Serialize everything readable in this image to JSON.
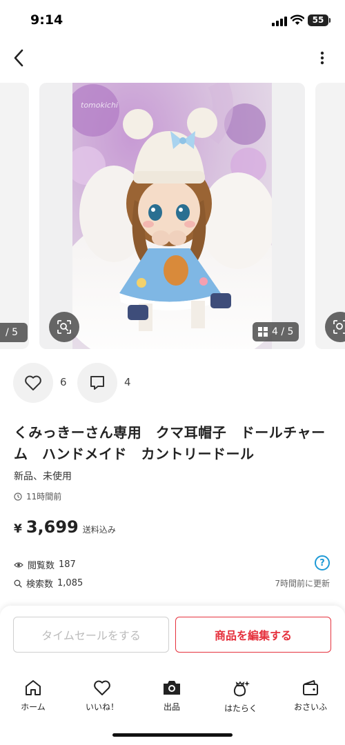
{
  "status_bar": {
    "time": "9:14",
    "battery": "55"
  },
  "icons": {
    "back": "chevron-left-icon",
    "more": "vertical-dots-icon",
    "lens": "image-search-icon",
    "grid": "grid-icon",
    "like": "heart-icon",
    "comment": "comment-icon",
    "clock": "clock-icon",
    "eye": "eye-icon",
    "search": "search-icon",
    "help": "help-icon"
  },
  "carousel": {
    "prev_counter": "/ 5",
    "counter": "4 / 5",
    "watermark": "tomokichi"
  },
  "actions": {
    "like_count": "6",
    "comment_count": "4"
  },
  "item": {
    "title": "くみっきーさん専用　クマ耳帽子　ドールチャーム　ハンドメイド　カントリードール",
    "condition": "新品、未使用",
    "posted": "11時間前",
    "price_currency": "¥",
    "price": "3,699",
    "price_note": "送料込み"
  },
  "stats": {
    "views_label": "閲覧数",
    "views": "187",
    "search_label": "検索数",
    "search": "1,085",
    "help_glyph": "?",
    "updated": "7時間前に更新"
  },
  "buttons": {
    "time_sale": "タイムセールをする",
    "edit": "商品を編集する"
  },
  "tabs": [
    {
      "label": "ホーム",
      "icon": "home-icon"
    },
    {
      "label": "いいね！",
      "icon": "heart-icon"
    },
    {
      "label": "出品",
      "icon": "camera-icon"
    },
    {
      "label": "はたらく",
      "icon": "sparkle-bag-icon"
    },
    {
      "label": "おさいふ",
      "icon": "wallet-icon"
    }
  ],
  "colors": {
    "accent_red": "#e5303c",
    "help_blue": "#1e9ad6",
    "chip_bg": "#464646"
  }
}
